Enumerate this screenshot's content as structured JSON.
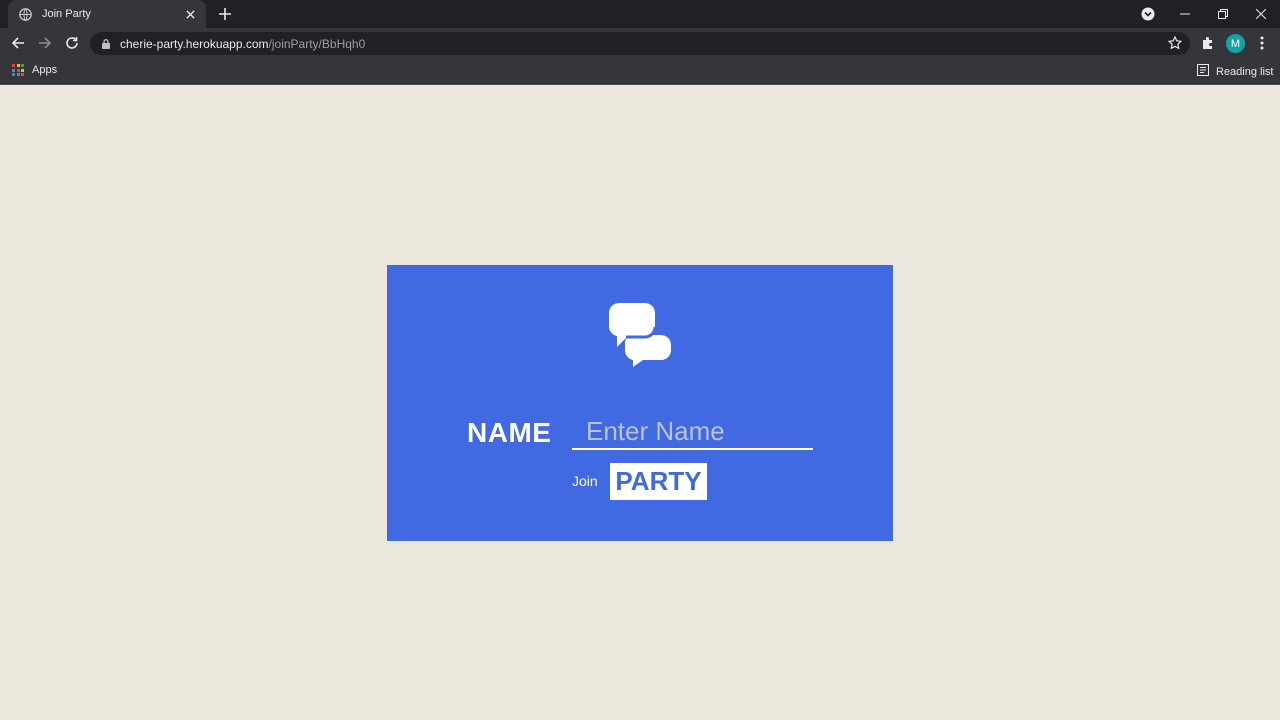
{
  "browser": {
    "tab_title": "Join Party",
    "url_host": "cherie-party.herokuapp.com",
    "url_path": "/joinParty/BbHqh0",
    "profile_initial": "M",
    "bookmarks": {
      "apps_label": "Apps",
      "reading_list_label": "Reading list"
    }
  },
  "page": {
    "logo_icon": "chat-bubbles-icon",
    "name_label": "NAME",
    "name_input": {
      "value": "",
      "placeholder": "Enter Name"
    },
    "join_label": "Join",
    "party_button_label": "PARTY"
  },
  "colors": {
    "page_background": "#ebe7dc",
    "card_background": "#4169e1",
    "button_background": "#ffffff",
    "button_text": "#4169e1"
  }
}
